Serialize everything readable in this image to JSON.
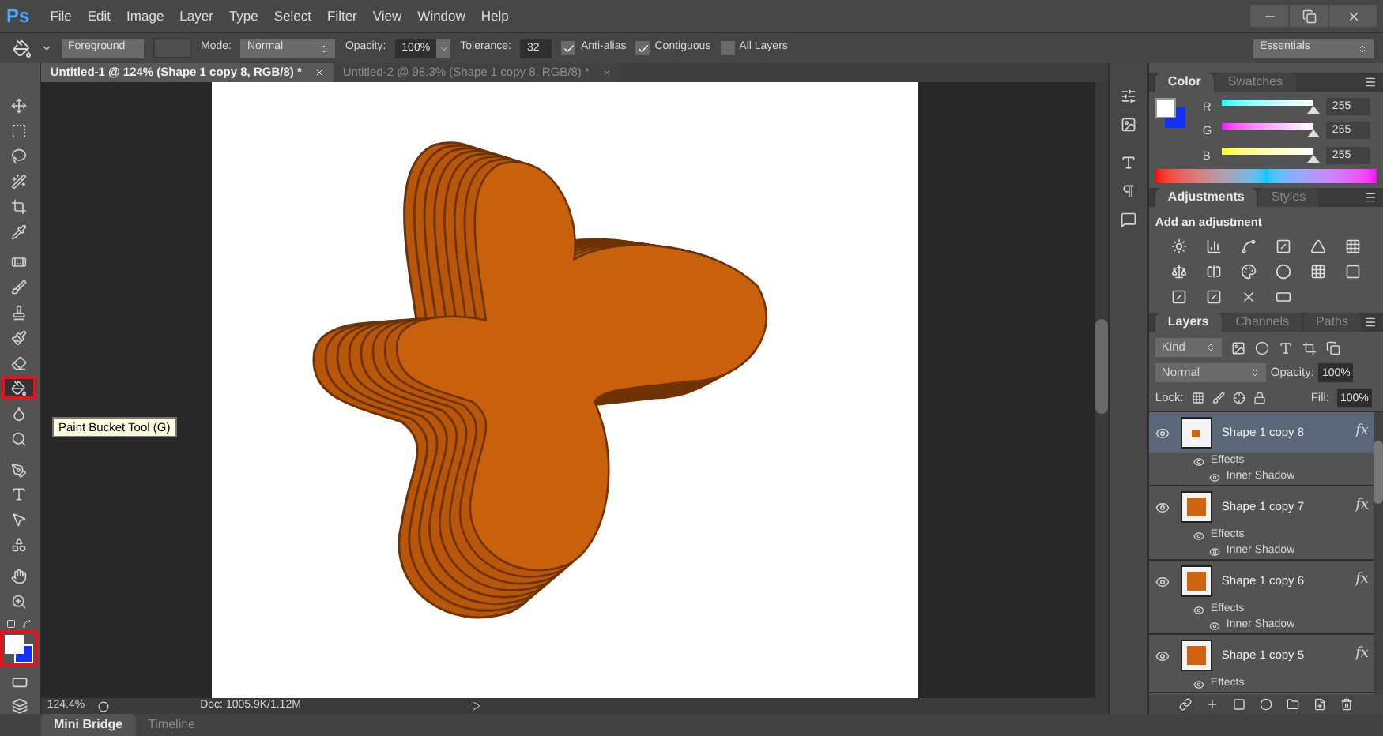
{
  "app_logo": "Ps",
  "menu": [
    "File",
    "Edit",
    "Image",
    "Layer",
    "Type",
    "Select",
    "Filter",
    "View",
    "Window",
    "Help"
  ],
  "options_bar": {
    "fill_source": "Foreground",
    "mode_label": "Mode:",
    "mode": "Normal",
    "opacity_label": "Opacity:",
    "opacity": "100%",
    "tolerance_label": "Tolerance:",
    "tolerance": "32",
    "checkboxes": [
      {
        "label": "Anti-alias",
        "checked": true
      },
      {
        "label": "Contiguous",
        "checked": true
      },
      {
        "label": "All Layers",
        "checked": false
      }
    ],
    "workspace": "Essentials"
  },
  "document_tabs": [
    {
      "title": "Untitled-1 @ 124% (Shape 1 copy 8, RGB/8) *",
      "selected": true
    },
    {
      "title": "Untitled-2 @ 98.3% (Shape 1 copy 8, RGB/8) *",
      "selected": false
    }
  ],
  "tools": [
    {
      "kind": "move",
      "selected": false
    },
    {
      "kind": "marquee",
      "selected": false
    },
    {
      "kind": "lasso",
      "selected": false
    },
    {
      "kind": "quick-select",
      "selected": false
    },
    {
      "kind": "crop",
      "selected": false
    },
    {
      "kind": "eyedropper",
      "selected": false
    },
    {
      "kind": "healing",
      "selected": false
    },
    {
      "kind": "brush",
      "selected": false
    },
    {
      "kind": "stamp",
      "selected": false
    },
    {
      "kind": "history-brush",
      "selected": false
    },
    {
      "kind": "eraser",
      "selected": false
    },
    {
      "kind": "paint-bucket",
      "selected": true
    },
    {
      "kind": "blur",
      "selected": false
    },
    {
      "kind": "dodge",
      "selected": false
    },
    {
      "kind": "pen",
      "selected": false
    },
    {
      "kind": "type",
      "selected": false
    },
    {
      "kind": "path-select",
      "selected": false
    },
    {
      "kind": "shape",
      "selected": false
    },
    {
      "kind": "hand",
      "selected": false
    },
    {
      "kind": "zoom",
      "selected": false
    }
  ],
  "color_swatches_highlighted": true,
  "tooltip": "Paint Bucket Tool (G)",
  "status_bar": {
    "zoom": "124.4%",
    "doc": "Doc: 1005.9K/1.12M"
  },
  "bottom_tabs": [
    {
      "label": "Mini Bridge",
      "selected": true
    },
    {
      "label": "Timeline",
      "selected": false
    }
  ],
  "color_panel": {
    "tabs": [
      {
        "label": "Color",
        "selected": true
      },
      {
        "label": "Swatches",
        "selected": false
      }
    ],
    "channels": [
      {
        "name": "R",
        "level": 1,
        "reading": "255"
      },
      {
        "name": "G",
        "level": 1,
        "reading": "255"
      },
      {
        "name": "B",
        "level": 1,
        "reading": "255"
      }
    ]
  },
  "adjustments_panel": {
    "tabs": [
      {
        "label": "Adjustments",
        "selected": true
      },
      {
        "label": "Styles",
        "selected": false
      }
    ],
    "heading": "Add an adjustment"
  },
  "layers_panel": {
    "tabs": [
      {
        "label": "Layers",
        "selected": true
      },
      {
        "label": "Channels",
        "selected": false
      },
      {
        "label": "Paths",
        "selected": false
      }
    ],
    "filter": "Kind",
    "blend_mode": "Normal",
    "opacity_label": "Opacity:",
    "opacity": "100%",
    "lock_label": "Lock:",
    "fill_label": "Fill:",
    "fill": "100%",
    "layers": [
      {
        "name": "Shape 1 copy 8",
        "selected": true,
        "visible": true,
        "fx": "fx",
        "effects_label": "Effects",
        "effects": [
          "Inner Shadow"
        ]
      },
      {
        "name": "Shape 1 copy 7",
        "selected": false,
        "visible": true,
        "fx": "fx",
        "effects_label": "Effects",
        "effects": [
          "Inner Shadow"
        ]
      },
      {
        "name": "Shape 1 copy 6",
        "selected": false,
        "visible": true,
        "fx": "fx",
        "effects_label": "Effects",
        "effects": [
          "Inner Shadow"
        ]
      },
      {
        "name": "Shape 1 copy 5",
        "selected": false,
        "visible": true,
        "fx": "fx",
        "effects_label": "Effects"
      }
    ]
  }
}
